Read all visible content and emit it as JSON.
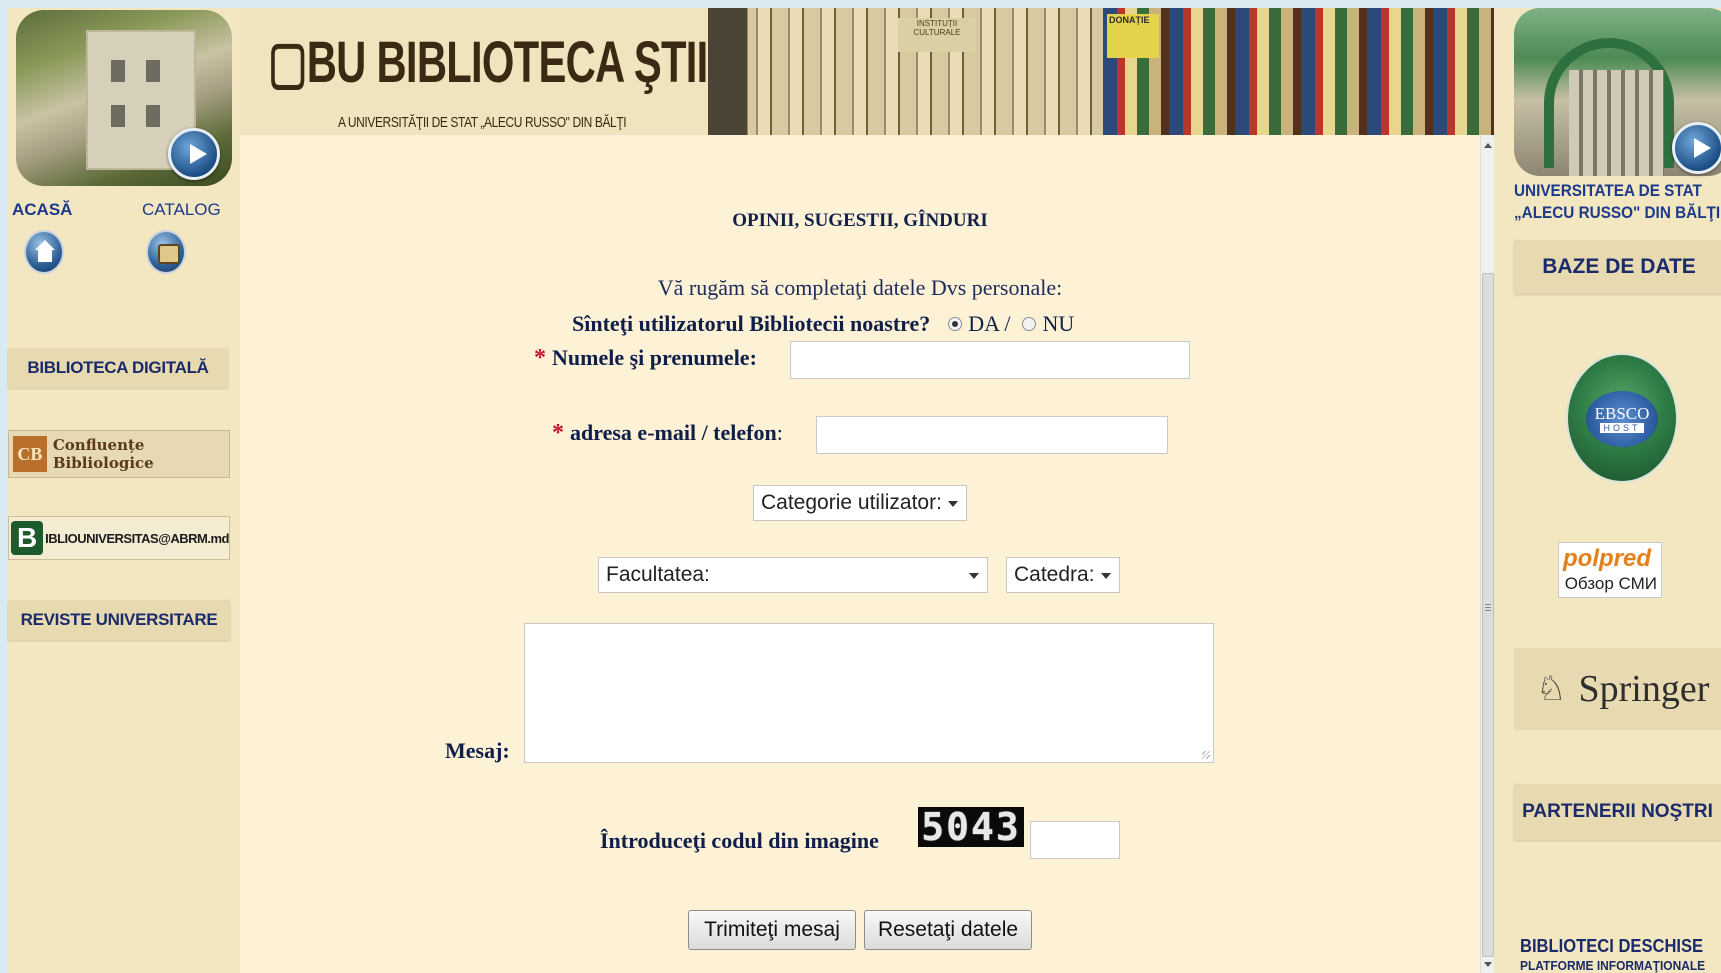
{
  "left_sidebar": {
    "nav_acasa": "ACASĂ",
    "nav_catalog": "CATALOG",
    "biblioteca_digitala": "BIBLIOTECA DIGITALĂ",
    "confluente_abbr": "CB",
    "confluente": "Confluențe Bibliologice",
    "biblio_universitas_initial": "B",
    "biblio_universitas": "IBLIOUNIVERSITAS@ABRM.md",
    "reviste": "REVISTE UNIVERSITARE"
  },
  "header": {
    "logo": "▢BU BIBLIOTECA ŞTIINŢIFICĂ",
    "subtitle": "A UNIVERSITĂŢII DE STAT „ALECU RUSSO\" DIN BĂLŢI",
    "donatie": "DONAȚIE",
    "institutie": "INSTITUȚII CULTURALE"
  },
  "form": {
    "title": "OPINII, SUGESTII, GÎNDURI",
    "intro": "Vă rugăm să completaţi datele Dvs personale:",
    "question": "Sînteţi utilizatorul Bibliotecii noastre?",
    "option_da": "DA /",
    "option_nu": "NU",
    "name_label": "Numele şi prenumele:",
    "email_label": "adresa e-mail / telefon",
    "email_colon": ":",
    "star": "*",
    "category_select": "Categorie utilizator:",
    "faculty_select": "Facultatea:",
    "catedra_select": "Catedra:",
    "message_label": "Mesaj:",
    "captcha_label": "Întroduceţi codul din imagine",
    "captcha_code": "5043",
    "submit": "Trimiteţi mesaj",
    "reset": "Resetaţi datele"
  },
  "right_sidebar": {
    "university_line1": "UNIVERSITATEA DE STAT",
    "university_line2": "„ALECU RUSSO\" DIN BĂLŢI",
    "baze_de_date": "BAZE DE DATE",
    "ebsco_line1": "EBSCO",
    "ebsco_line2": "HOST",
    "polpred_1": "polpred",
    "polpred_2": "Обзор СМИ",
    "springer": "Springer",
    "partenerii": "PARTENERII NOŞTRI",
    "biblioteci_deschise": "BIBLIOTECI DESCHISE",
    "platforme": "PLATFORME INFORMAŢIONALE"
  },
  "colors": {
    "page_bg": "#fdf1d6",
    "sidebar_bg": "#f2e7c0",
    "heading_navy": "#0f1f4a",
    "required_red": "#c8102e"
  }
}
